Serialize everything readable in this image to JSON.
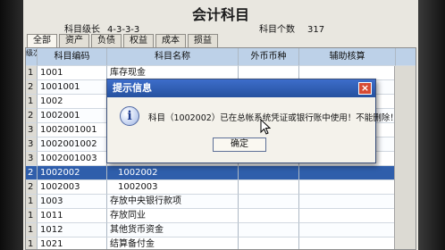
{
  "window": {
    "title": "会计科目",
    "level_label": "科目级长",
    "level_value": "4-3-3-3",
    "count_label": "科目个数",
    "count_value": "317"
  },
  "tabs": [
    {
      "label": "全部",
      "active": true
    },
    {
      "label": "资产",
      "active": false
    },
    {
      "label": "负债",
      "active": false
    },
    {
      "label": "权益",
      "active": false
    },
    {
      "label": "成本",
      "active": false
    },
    {
      "label": "损益",
      "active": false
    }
  ],
  "table": {
    "headers": [
      "级次",
      "科目编码",
      "科目名称",
      "外币币种",
      "辅助核算"
    ],
    "rows": [
      {
        "level": "1",
        "code": "1001",
        "name": "库存现金"
      },
      {
        "level": "2",
        "code": "1001001",
        "name": ""
      },
      {
        "level": "1",
        "code": "1002",
        "name": ""
      },
      {
        "level": "2",
        "code": "1002001",
        "name": ""
      },
      {
        "level": "3",
        "code": "1002001001",
        "name": ""
      },
      {
        "level": "3",
        "code": "1002001002",
        "name": ""
      },
      {
        "level": "3",
        "code": "1002001003",
        "name": ""
      },
      {
        "level": "2",
        "code": "1002002",
        "name": "1002002"
      },
      {
        "level": "2",
        "code": "1002003",
        "name": "1002003"
      },
      {
        "level": "1",
        "code": "1003",
        "name": "存放中央银行款项"
      },
      {
        "level": "1",
        "code": "1011",
        "name": "存放同业"
      },
      {
        "level": "1",
        "code": "1012",
        "name": "其他货币资金"
      },
      {
        "level": "1",
        "code": "1021",
        "name": "结算备付金"
      }
    ],
    "selected_row": 7
  },
  "dialog": {
    "title": "提示信息",
    "close": "×",
    "icon": "i",
    "message": "科目（1002002）已在总帐系统凭证或银行账中使用！不能删除！",
    "ok_label": "确定"
  },
  "colors": {
    "header_bg": "#b9cde3",
    "selection": "#2e5ca8",
    "dialog_title": "#244f9c",
    "close_button": "#d34a33"
  }
}
